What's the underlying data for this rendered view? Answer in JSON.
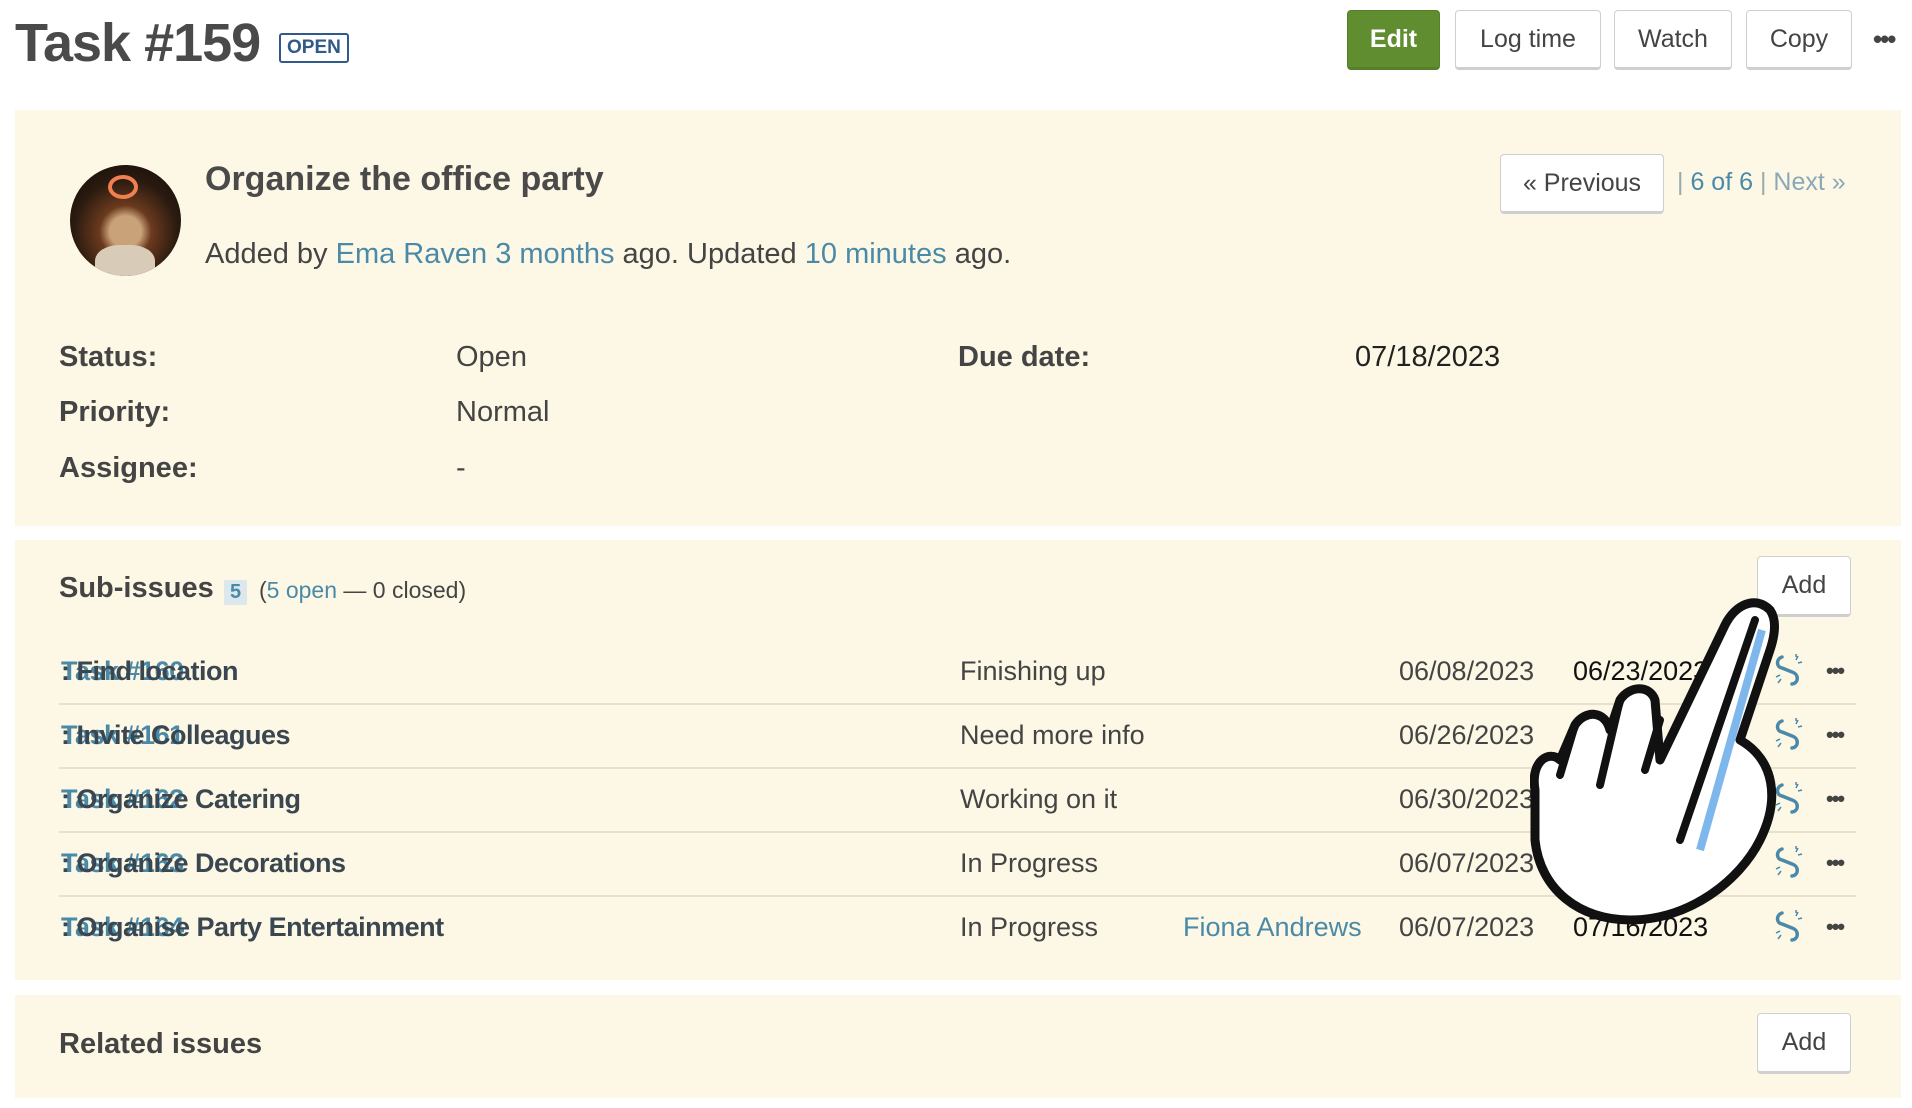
{
  "header": {
    "title": "Task #159",
    "status_badge": "OPEN",
    "buttons": {
      "edit": "Edit",
      "log_time": "Log time",
      "watch": "Watch",
      "copy": "Copy",
      "more": "•••"
    }
  },
  "task": {
    "name": "Organize the office party",
    "added_by_prefix": "Added by",
    "author": "Ema Raven",
    "created_ago": "3 months",
    "ago1": "ago. Updated",
    "updated_ago": "10 minutes",
    "ago2": "ago.",
    "pager": {
      "previous": "« Previous",
      "sep1": "|",
      "position": "6 of 6",
      "sep2": "|",
      "next": "Next »"
    },
    "fields": {
      "status_label": "Status:",
      "status": "Open",
      "priority_label": "Priority:",
      "priority": "Normal",
      "assignee_label": "Assignee:",
      "assignee": "-",
      "due_label": "Due date:",
      "due": "07/18/2023"
    }
  },
  "subissues": {
    "title": "Sub-issues",
    "count": "5",
    "open_open": "(",
    "open_link": "5 open",
    "closed": "— 0 closed)",
    "add": "Add",
    "rows": [
      {
        "id": "Task #160",
        "name": ": Find location",
        "status": "Finishing up",
        "assignee": "",
        "start": "06/08/2023",
        "due": "06/23/2023"
      },
      {
        "id": "Task #161",
        "name": ": Invite Colleagues",
        "status": "Need more info",
        "assignee": "",
        "start": "06/26/2023",
        "due": ""
      },
      {
        "id": "Task #162",
        "name": ": Organize Catering",
        "status": "Working on it",
        "assignee": "",
        "start": "06/30/2023",
        "due": ""
      },
      {
        "id": "Task #163",
        "name": ": Organize Decorations",
        "status": "In Progress",
        "assignee": "",
        "start": "06/07/2023",
        "due": ""
      },
      {
        "id": "Task #164",
        "name": ": Organise Party Entertainment",
        "status": "In Progress",
        "assignee": "Fiona Andrews",
        "start": "06/07/2023",
        "due": "07/16/2023"
      }
    ],
    "row_more": "•••"
  },
  "related": {
    "title": "Related issues",
    "add": "Add"
  },
  "colors": {
    "accent_green": "#5f8d2f",
    "link": "#4a8aa8",
    "panel": "#fdf8e5",
    "badge": "#2f5a8a"
  },
  "icons": {
    "row_action": "unlink-icon",
    "cursor": "pointing-hand-cursor"
  }
}
